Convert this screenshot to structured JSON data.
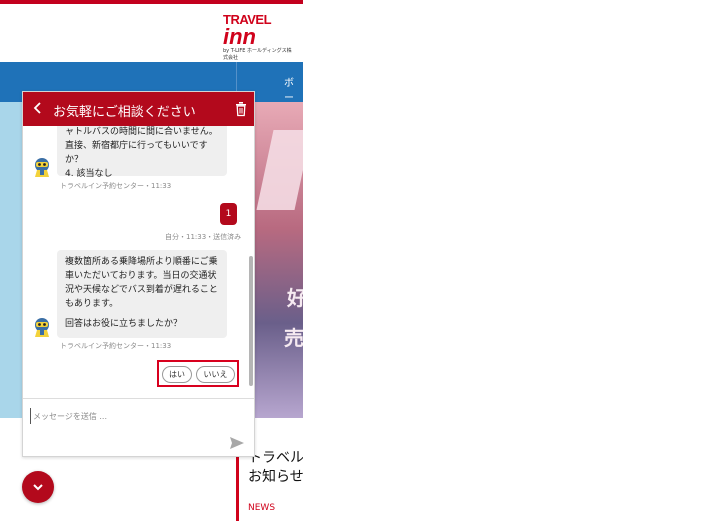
{
  "site": {
    "logo_top": "TRAVEL",
    "logo_big": "inn",
    "logo_sub": "by T-LIFE ホールディングス株式会社",
    "nav_item": "ボー",
    "hero_text1": "好",
    "hero_text2": "売",
    "news_title_line1": "トラベル",
    "news_title_line2": "お知らせ",
    "news_label": "NEWS"
  },
  "chat": {
    "title": "お気軽にご相談ください",
    "messages": [
      {
        "lines": [
          "ャトルバスの時間に間に合いません。",
          "直接、新宿都庁に行ってもいいです",
          "か？",
          "4. 該当なし"
        ],
        "meta": "トラベルイン予約センター・11:33"
      },
      {
        "text": "1",
        "meta": "自分・11:33・送信済み"
      },
      {
        "lines": [
          "複数箇所ある乗降場所より順番にご乗",
          "車いただいております。当日の交通状",
          "況や天候などでバス到着が遅れること",
          "もあります。",
          "",
          "回答はお役に立ちましたか？"
        ],
        "meta": "トラベルイン予約センター・11:33"
      }
    ],
    "quick_replies": [
      "はい",
      "いいえ"
    ],
    "input_placeholder": "メッセージを送信 ..."
  },
  "colors": {
    "brand_red": "#b3091c",
    "nav_blue": "#1f72b8",
    "bubble_gray": "#efefef"
  },
  "icons": {
    "back": "chevron-left-icon",
    "trash": "trash-icon",
    "send": "send-icon",
    "minimize": "chevron-down-icon",
    "avatar": "bot-avatar-icon"
  }
}
